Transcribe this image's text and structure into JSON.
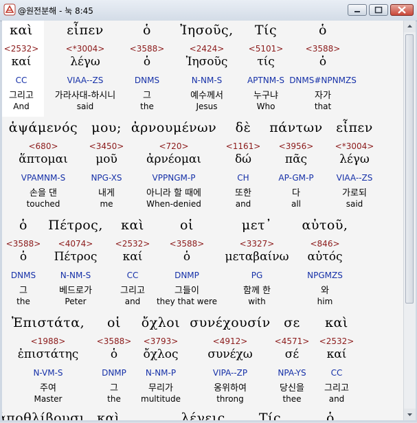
{
  "window": {
    "title": "@원전분해 - 눅 8:45"
  },
  "rows": [
    {
      "words": [
        {
          "greek": "καὶ",
          "strong": "<2532>",
          "lexeme": "καί",
          "morph": "CC",
          "korean": "그리고",
          "english": "And"
        },
        {
          "greek": "εἶπεν",
          "strong": "<*3004>",
          "lexeme": "λέγω",
          "morph": "VIAA--ZS",
          "korean": "가라사대-하시니",
          "english": "said"
        },
        {
          "greek": "ὁ",
          "strong": "<3588>",
          "lexeme": "ὁ",
          "morph": "DNMS",
          "korean": "그",
          "english": "the"
        },
        {
          "greek": "Ἰησοῦς,",
          "strong": "<2424>",
          "lexeme": "Ἰησοῦς",
          "morph": "N-NM-S",
          "korean": "예수께서",
          "english": "Jesus"
        },
        {
          "greek": "Τίς",
          "strong": "<5101>",
          "lexeme": "τίς",
          "morph": "APTNM-S",
          "korean": "누구냐",
          "english": "Who"
        },
        {
          "greek": "ὁ",
          "strong": "<3588>",
          "lexeme": "ὁ",
          "morph": "DNMS#NPNMZS",
          "korean": "자가",
          "english": "that"
        }
      ]
    },
    {
      "words": [
        {
          "greek": "ἁψάμενός",
          "strong": "<680>",
          "lexeme": "ἅπτομαι",
          "morph": "VPAMNM-S",
          "korean": "손을 댄",
          "english": "touched"
        },
        {
          "greek": "μου;",
          "strong": "<3450>",
          "lexeme": "μοῦ",
          "morph": "NPG-XS",
          "korean": "내게",
          "english": "me"
        },
        {
          "greek": "ἀρνουμένων",
          "strong": "<720>",
          "lexeme": "ἀρνέομαι",
          "morph": "VPPNGM-P",
          "korean": "아니라 할 때에",
          "english": "When-denied"
        },
        {
          "greek": "δὲ",
          "strong": "<1161>",
          "lexeme": "δώ",
          "morph": "CH",
          "korean": "또한",
          "english": "and"
        },
        {
          "greek": "πάντων",
          "strong": "<3956>",
          "lexeme": "πᾶς",
          "morph": "AP-GM-P",
          "korean": "다",
          "english": "all"
        },
        {
          "greek": "εἶπεν",
          "strong": "<*3004>",
          "lexeme": "λέγω",
          "morph": "VIAA--ZS",
          "korean": "가로되",
          "english": "said"
        }
      ]
    },
    {
      "words": [
        {
          "greek": "ὁ",
          "strong": "<3588>",
          "lexeme": "ὁ",
          "morph": "DNMS",
          "korean": "그",
          "english": "the"
        },
        {
          "greek": "Πέτρος,",
          "strong": "<4074>",
          "lexeme": "Πέτρος",
          "morph": "N-NM-S",
          "korean": "베드로가",
          "english": "Peter"
        },
        {
          "greek": "καὶ",
          "strong": "<2532>",
          "lexeme": "καί",
          "morph": "CC",
          "korean": "그리고",
          "english": "and"
        },
        {
          "greek": "οἱ",
          "strong": "<3588>",
          "lexeme": "ὁ",
          "morph": "DNMP",
          "korean": "그들이",
          "english": "they that were"
        },
        {
          "greek": "μετ᾽",
          "strong": "<3327>",
          "lexeme": "μεταβαίνω",
          "morph": "PG",
          "korean": "함께 한",
          "english": "with"
        },
        {
          "greek": "αὐτοῦ,",
          "strong": "<846>",
          "lexeme": "αὐτός",
          "morph": "NPGMZS",
          "korean": "와",
          "english": "him"
        }
      ]
    },
    {
      "words": [
        {
          "greek": "Ἐπιστάτα,",
          "strong": "<1988>",
          "lexeme": "ἐπιστάτης",
          "morph": "N-VM-S",
          "korean": "주여",
          "english": "Master"
        },
        {
          "greek": "οἱ",
          "strong": "<3588>",
          "lexeme": "ὁ",
          "morph": "DNMP",
          "korean": "그",
          "english": "the"
        },
        {
          "greek": "ὄχλοι",
          "strong": "<3793>",
          "lexeme": "ὄχλος",
          "morph": "N-NM-P",
          "korean": "무리가",
          "english": "multitude"
        },
        {
          "greek": "συνέχουσίν",
          "strong": "<4912>",
          "lexeme": "συνέχω",
          "morph": "VIPA--ZP",
          "korean": "옹위하여",
          "english": "throng"
        },
        {
          "greek": "σε",
          "strong": "<4571>",
          "lexeme": "σέ",
          "morph": "NPA-YS",
          "korean": "당신을",
          "english": "thee"
        },
        {
          "greek": "καὶ",
          "strong": "<2532>",
          "lexeme": "καί",
          "morph": "CC",
          "korean": "그리고",
          "english": "and"
        }
      ]
    }
  ],
  "partial_row": [
    "ἀποθλίβουσι,",
    "καὶ",
    "λέγεις,",
    "Τίς",
    "ὁ"
  ]
}
